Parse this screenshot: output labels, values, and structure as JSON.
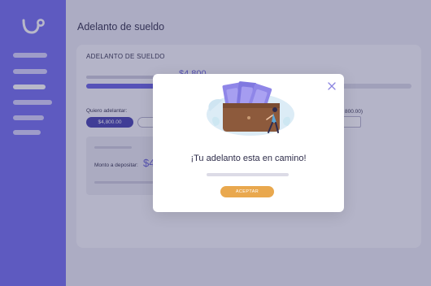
{
  "header": {
    "title": "Adelanto de sueldo"
  },
  "sidebar": {
    "logo_icon": "smile-hook-logo",
    "items": [
      {
        "icon": "menu-line",
        "active": false
      },
      {
        "icon": "menu-line",
        "active": false
      },
      {
        "icon": "menu-line",
        "active": true
      },
      {
        "icon": "menu-line",
        "active": false
      },
      {
        "icon": "menu-line",
        "active": false
      },
      {
        "icon": "menu-line",
        "active": false
      }
    ]
  },
  "card": {
    "title": "ADELANTO DE SUELDO",
    "amount_partial": "$4,800",
    "progress_fraction": 0.52,
    "advance_label": "Quiero adelantar:",
    "advance_value": "$4,800.00",
    "right_hint": "800.00)",
    "deposit_label": "Monto a depositar:",
    "deposit_amount_partial": "$4"
  },
  "modal": {
    "title": "¡Tu adelanto esta en camino!",
    "accept_label": "ACEPTAR",
    "close_icon": "close-icon"
  },
  "colors": {
    "sidebar": "#7a73f2",
    "accent": "#6e68e6",
    "pill": "#4d48b3",
    "button": "#e9a84e",
    "wallet": "#8d5a3c",
    "bills": "#8f86e8"
  }
}
